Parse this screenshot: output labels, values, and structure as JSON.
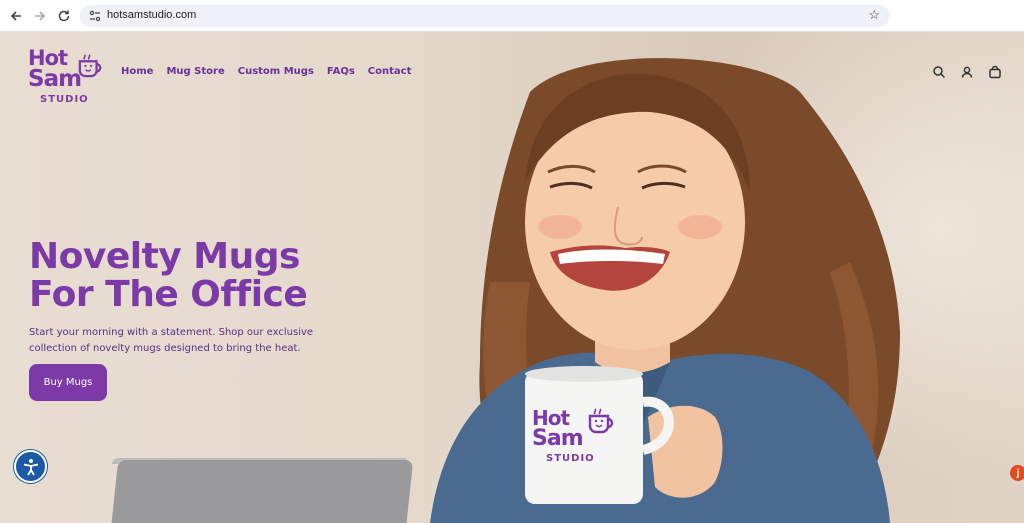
{
  "browser": {
    "url": "hotsamstudio.com"
  },
  "brand": {
    "line1": "Hot",
    "line2": "Sam",
    "line3": "STUDIO",
    "color": "#7b3aa8"
  },
  "nav": {
    "items": [
      "Home",
      "Mug Store",
      "Custom Mugs",
      "FAQs",
      "Contact"
    ]
  },
  "header_icons": [
    "search-icon",
    "account-icon",
    "cart-icon"
  ],
  "hero": {
    "headline_line1": "Novelty Mugs",
    "headline_line2": "For The Office",
    "subtext": "Start your morning with a statement. Shop our exclusive collection of novelty mugs designed to bring the heat.",
    "cta_label": "Buy Mugs"
  },
  "mug_logo": {
    "line1": "Hot",
    "line2": "Sam",
    "line3": "STUDIO"
  },
  "chat_badge": "j"
}
